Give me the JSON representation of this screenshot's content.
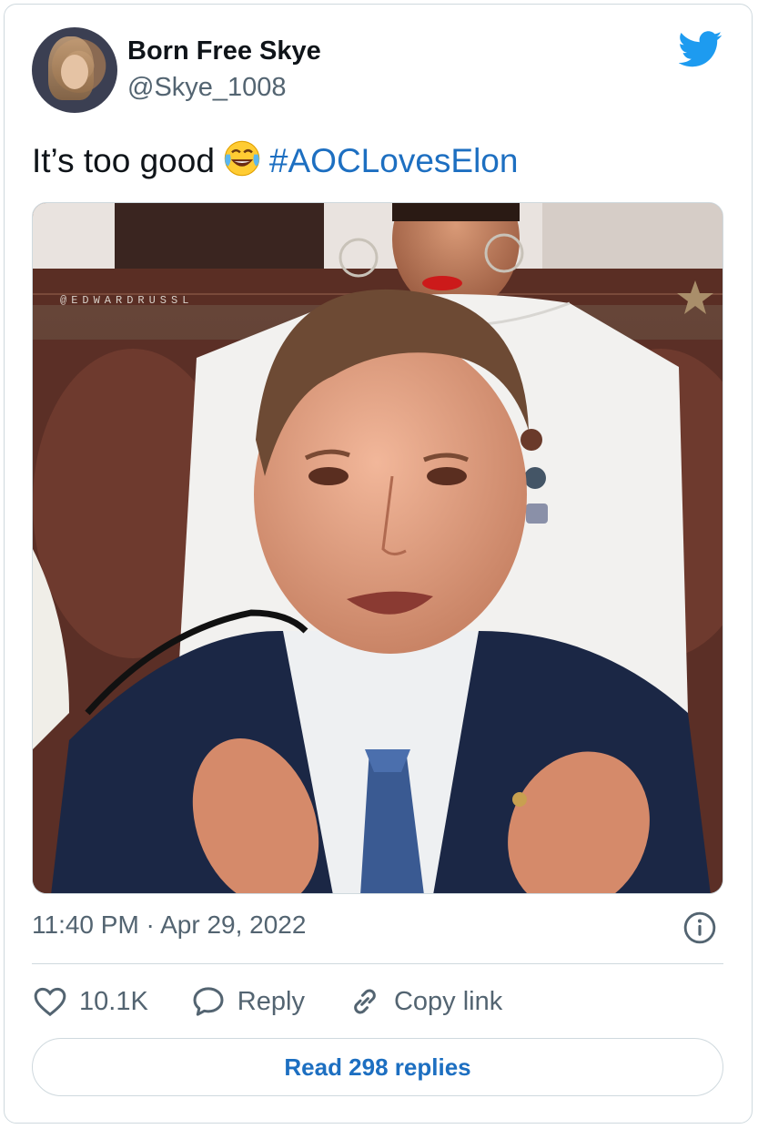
{
  "author": {
    "display_name": "Born Free Skye",
    "handle": "@Skye_1008"
  },
  "tweet": {
    "text": "It’s too good",
    "emoji": "face-with-tears-of-joy",
    "hashtag": "#AOCLovesElon",
    "media_watermark": "@EDWARDRUSSL"
  },
  "meta": {
    "timestamp": "11:40 PM · Apr 29, 2022"
  },
  "actions": {
    "like_count": "10.1K",
    "reply_label": "Reply",
    "copy_link_label": "Copy link"
  },
  "read_replies_label": "Read 298 replies",
  "colors": {
    "brand": "#1d9bf0",
    "link": "#1d6fc1",
    "muted": "#536471",
    "like_outline": "#536471"
  },
  "icons": [
    "twitter-bird-icon",
    "emoji-tears-of-joy-icon",
    "info-icon",
    "heart-icon",
    "reply-bubble-icon",
    "link-icon"
  ]
}
